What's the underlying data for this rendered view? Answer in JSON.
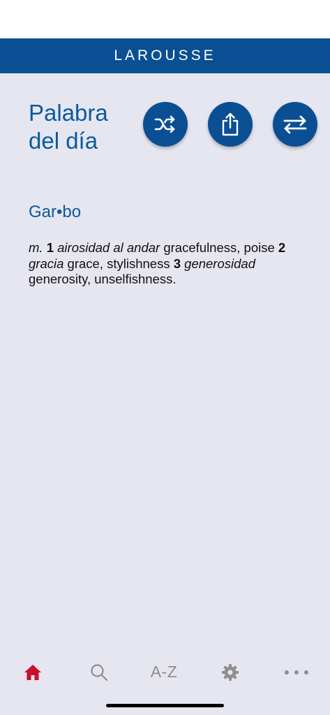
{
  "header": {
    "brand": "LAROUSSE"
  },
  "main": {
    "title_line1": "Palabra",
    "title_line2": "del día",
    "actions": {
      "shuffle_icon": "shuffle-icon",
      "share_icon": "share-icon",
      "swap_icon": "swap-arrows-icon"
    },
    "entry": {
      "headword": "Gar•bo",
      "gender": "m.",
      "senses": [
        {
          "num": "1",
          "spanish": "airosidad al andar",
          "english": "gracefulness, poise"
        },
        {
          "num": "2",
          "spanish": "gracia",
          "english": "grace, stylishness"
        },
        {
          "num": "3",
          "spanish": "generosidad",
          "english": "generosity, unselfishness."
        }
      ]
    }
  },
  "tabbar": {
    "home_icon": "home-icon",
    "search_icon": "search-icon",
    "az_label": "A-Z",
    "settings_icon": "gear-icon",
    "more_icon": "more-dots-icon"
  },
  "colors": {
    "brand_blue": "#0a4f93",
    "title_blue": "#0a5a9e",
    "background": "#e6e6f0",
    "active_tab": "#c8102e",
    "inactive_tab": "#8e8e8e"
  }
}
